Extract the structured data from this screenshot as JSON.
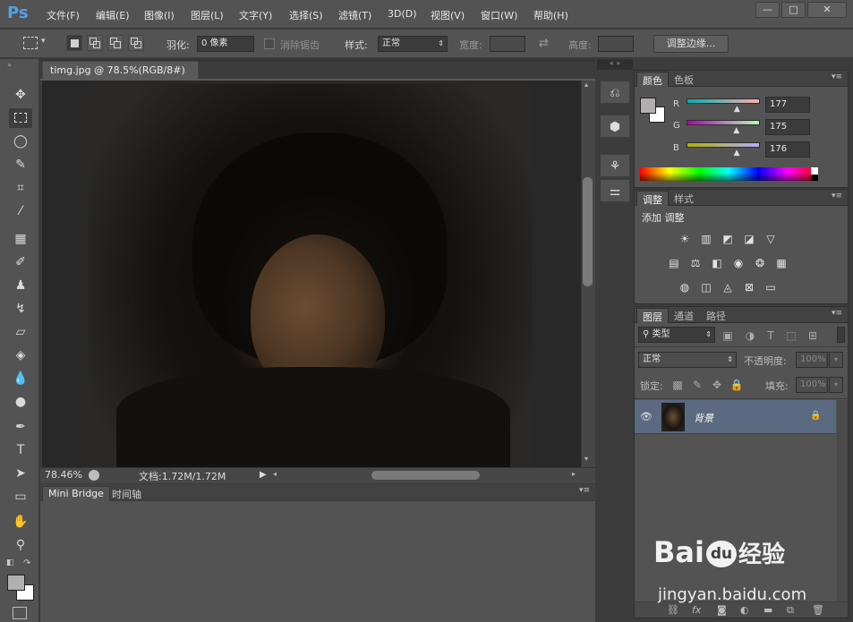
{
  "app": {
    "logo": "Ps"
  },
  "menu": [
    "文件(F)",
    "编辑(E)",
    "图像(I)",
    "图层(L)",
    "文字(Y)",
    "选择(S)",
    "滤镜(T)",
    "3D(D)",
    "视图(V)",
    "窗口(W)",
    "帮助(H)"
  ],
  "window_controls": {
    "minimize": "—",
    "maximize": "□",
    "close": "✕"
  },
  "options": {
    "feather_label": "羽化:",
    "feather_value": "0 像素",
    "antialias_label": "消除锯齿",
    "style_label": "样式:",
    "style_value": "正常",
    "width_label": "宽度:",
    "height_label": "高度:",
    "refine_edge": "调整边缘..."
  },
  "document": {
    "tab_title": "timg.jpg @ 78.5%(RGB/8#)",
    "tab_close": "×",
    "zoom": "78.46%",
    "doc_size": "文档:1.72M/1.72M"
  },
  "bottom_panel": {
    "tabs": [
      "Mini Bridge",
      "时间轴"
    ]
  },
  "color_panel": {
    "tabs": [
      "颜色",
      "色板"
    ],
    "channels": [
      {
        "label": "R",
        "value": "177",
        "fraction": 0.694
      },
      {
        "label": "G",
        "value": "175",
        "fraction": 0.686
      },
      {
        "label": "B",
        "value": "176",
        "fraction": 0.69
      }
    ],
    "foreground": "#b1afb0",
    "background": "#ffffff"
  },
  "adjust_panel": {
    "tabs": [
      "调整",
      "样式"
    ],
    "heading": "添加 调整"
  },
  "layers_panel": {
    "tabs": [
      "图层",
      "通道",
      "路径"
    ],
    "filter_kind": "类型",
    "blend_mode": "正常",
    "opacity_label": "不透明度:",
    "opacity_value": "100%",
    "lock_label": "锁定:",
    "fill_label": "填充:",
    "fill_value": "100%",
    "layer_name": "背景"
  },
  "watermark": {
    "brand": "Bai",
    "brand_mid": "du",
    "brand_cn": "经验",
    "url": "jingyan.baidu.com"
  },
  "colors": {
    "accent_blue": "#4fa3e6",
    "panel": "#535353",
    "selected_layer": "#5b6a80"
  }
}
